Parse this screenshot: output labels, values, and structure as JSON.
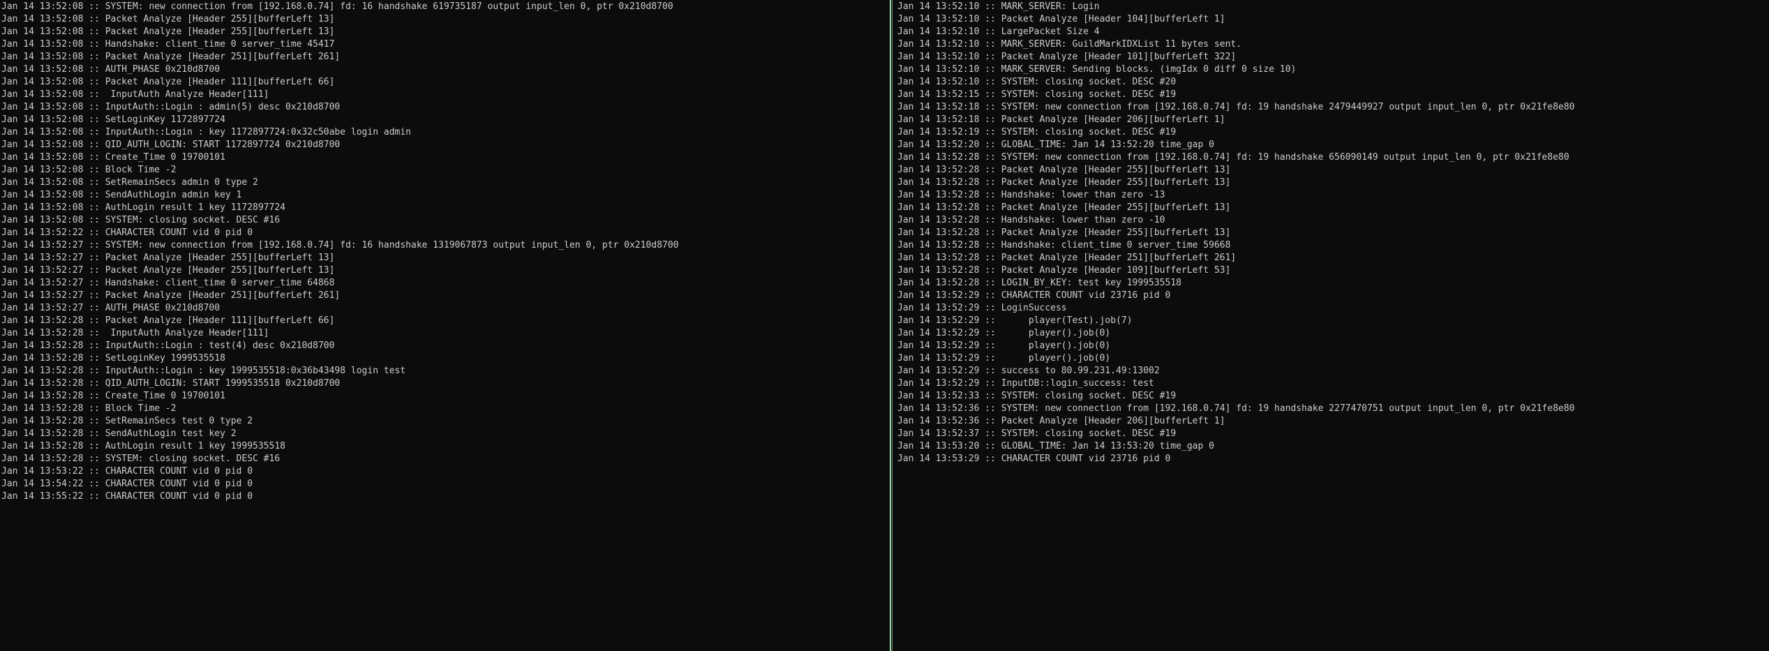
{
  "left_pane": {
    "lines": [
      "Jan 14 13:52:08 :: SYSTEM: new connection from [192.168.0.74] fd: 16 handshake 619735187 output input_len 0, ptr 0x210d8700",
      "Jan 14 13:52:08 :: Packet Analyze [Header 255][bufferLeft 13]",
      "Jan 14 13:52:08 :: Packet Analyze [Header 255][bufferLeft 13]",
      "Jan 14 13:52:08 :: Handshake: client_time 0 server_time 45417",
      "Jan 14 13:52:08 :: Packet Analyze [Header 251][bufferLeft 261]",
      "Jan 14 13:52:08 :: AUTH_PHASE 0x210d8700",
      "Jan 14 13:52:08 :: Packet Analyze [Header 111][bufferLeft 66]",
      "Jan 14 13:52:08 ::  InputAuth Analyze Header[111]",
      "Jan 14 13:52:08 :: InputAuth::Login : admin(5) desc 0x210d8700",
      "Jan 14 13:52:08 :: SetLoginKey 1172897724",
      "Jan 14 13:52:08 :: InputAuth::Login : key 1172897724:0x32c50abe login admin",
      "Jan 14 13:52:08 :: QID_AUTH_LOGIN: START 1172897724 0x210d8700",
      "Jan 14 13:52:08 :: Create_Time 0 19700101",
      "Jan 14 13:52:08 :: Block Time -2",
      "Jan 14 13:52:08 :: SetRemainSecs admin 0 type 2",
      "Jan 14 13:52:08 :: SendAuthLogin admin key 1",
      "Jan 14 13:52:08 :: AuthLogin result 1 key 1172897724",
      "Jan 14 13:52:08 :: SYSTEM: closing socket. DESC #16",
      "Jan 14 13:52:22 :: CHARACTER COUNT vid 0 pid 0",
      "Jan 14 13:52:27 :: SYSTEM: new connection from [192.168.0.74] fd: 16 handshake 1319067873 output input_len 0, ptr 0x210d8700",
      "Jan 14 13:52:27 :: Packet Analyze [Header 255][bufferLeft 13]",
      "Jan 14 13:52:27 :: Packet Analyze [Header 255][bufferLeft 13]",
      "Jan 14 13:52:27 :: Handshake: client_time 0 server_time 64868",
      "Jan 14 13:52:27 :: Packet Analyze [Header 251][bufferLeft 261]",
      "Jan 14 13:52:27 :: AUTH_PHASE 0x210d8700",
      "Jan 14 13:52:28 :: Packet Analyze [Header 111][bufferLeft 66]",
      "Jan 14 13:52:28 ::  InputAuth Analyze Header[111]",
      "Jan 14 13:52:28 :: InputAuth::Login : test(4) desc 0x210d8700",
      "Jan 14 13:52:28 :: SetLoginKey 1999535518",
      "Jan 14 13:52:28 :: InputAuth::Login : key 1999535518:0x36b43498 login test",
      "Jan 14 13:52:28 :: QID_AUTH_LOGIN: START 1999535518 0x210d8700",
      "Jan 14 13:52:28 :: Create_Time 0 19700101",
      "Jan 14 13:52:28 :: Block Time -2",
      "Jan 14 13:52:28 :: SetRemainSecs test 0 type 2",
      "Jan 14 13:52:28 :: SendAuthLogin test key 2",
      "Jan 14 13:52:28 :: AuthLogin result 1 key 1999535518",
      "Jan 14 13:52:28 :: SYSTEM: closing socket. DESC #16",
      "Jan 14 13:53:22 :: CHARACTER COUNT vid 0 pid 0",
      "Jan 14 13:54:22 :: CHARACTER COUNT vid 0 pid 0",
      "Jan 14 13:55:22 :: CHARACTER COUNT vid 0 pid 0"
    ]
  },
  "right_pane": {
    "lines": [
      "Jan 14 13:52:10 :: MARK_SERVER: Login",
      "Jan 14 13:52:10 :: Packet Analyze [Header 104][bufferLeft 1]",
      "Jan 14 13:52:10 :: LargePacket Size 4",
      "Jan 14 13:52:10 :: MARK_SERVER: GuildMarkIDXList 11 bytes sent.",
      "Jan 14 13:52:10 :: Packet Analyze [Header 101][bufferLeft 322]",
      "Jan 14 13:52:10 :: MARK_SERVER: Sending blocks. (imgIdx 0 diff 0 size 10)",
      "Jan 14 13:52:10 :: SYSTEM: closing socket. DESC #20",
      "Jan 14 13:52:15 :: SYSTEM: closing socket. DESC #19",
      "Jan 14 13:52:18 :: SYSTEM: new connection from [192.168.0.74] fd: 19 handshake 2479449927 output input_len 0, ptr 0x21fe8e80",
      "Jan 14 13:52:18 :: Packet Analyze [Header 206][bufferLeft 1]",
      "Jan 14 13:52:19 :: SYSTEM: closing socket. DESC #19",
      "Jan 14 13:52:20 :: GLOBAL_TIME: Jan 14 13:52:20 time_gap 0",
      "Jan 14 13:52:28 :: SYSTEM: new connection from [192.168.0.74] fd: 19 handshake 656090149 output input_len 0, ptr 0x21fe8e80",
      "Jan 14 13:52:28 :: Packet Analyze [Header 255][bufferLeft 13]",
      "Jan 14 13:52:28 :: Packet Analyze [Header 255][bufferLeft 13]",
      "Jan 14 13:52:28 :: Handshake: lower than zero -13",
      "Jan 14 13:52:28 :: Packet Analyze [Header 255][bufferLeft 13]",
      "Jan 14 13:52:28 :: Handshake: lower than zero -10",
      "Jan 14 13:52:28 :: Packet Analyze [Header 255][bufferLeft 13]",
      "Jan 14 13:52:28 :: Handshake: client_time 0 server_time 59668",
      "Jan 14 13:52:28 :: Packet Analyze [Header 251][bufferLeft 261]",
      "Jan 14 13:52:28 :: Packet Analyze [Header 109][bufferLeft 53]",
      "Jan 14 13:52:28 :: LOGIN_BY_KEY: test key 1999535518",
      "Jan 14 13:52:29 :: CHARACTER COUNT vid 23716 pid 0",
      "Jan 14 13:52:29 :: LoginSuccess",
      "Jan 14 13:52:29 ::      player(Test).job(7)",
      "Jan 14 13:52:29 ::      player().job(0)",
      "Jan 14 13:52:29 ::      player().job(0)",
      "Jan 14 13:52:29 ::      player().job(0)",
      "Jan 14 13:52:29 :: success to 80.99.231.49:13002",
      "Jan 14 13:52:29 :: InputDB::login_success: test",
      "Jan 14 13:52:33 :: SYSTEM: closing socket. DESC #19",
      "Jan 14 13:52:36 :: SYSTEM: new connection from [192.168.0.74] fd: 19 handshake 2277470751 output input_len 0, ptr 0x21fe8e80",
      "Jan 14 13:52:36 :: Packet Analyze [Header 206][bufferLeft 1]",
      "Jan 14 13:52:37 :: SYSTEM: closing socket. DESC #19",
      "Jan 14 13:53:20 :: GLOBAL_TIME: Jan 14 13:53:20 time_gap 0",
      "Jan 14 13:53:29 :: CHARACTER COUNT vid 23716 pid 0"
    ]
  },
  "colors": {
    "background": "#0c0c0c",
    "text": "#cccccc",
    "divider": "#9fd3a8"
  }
}
